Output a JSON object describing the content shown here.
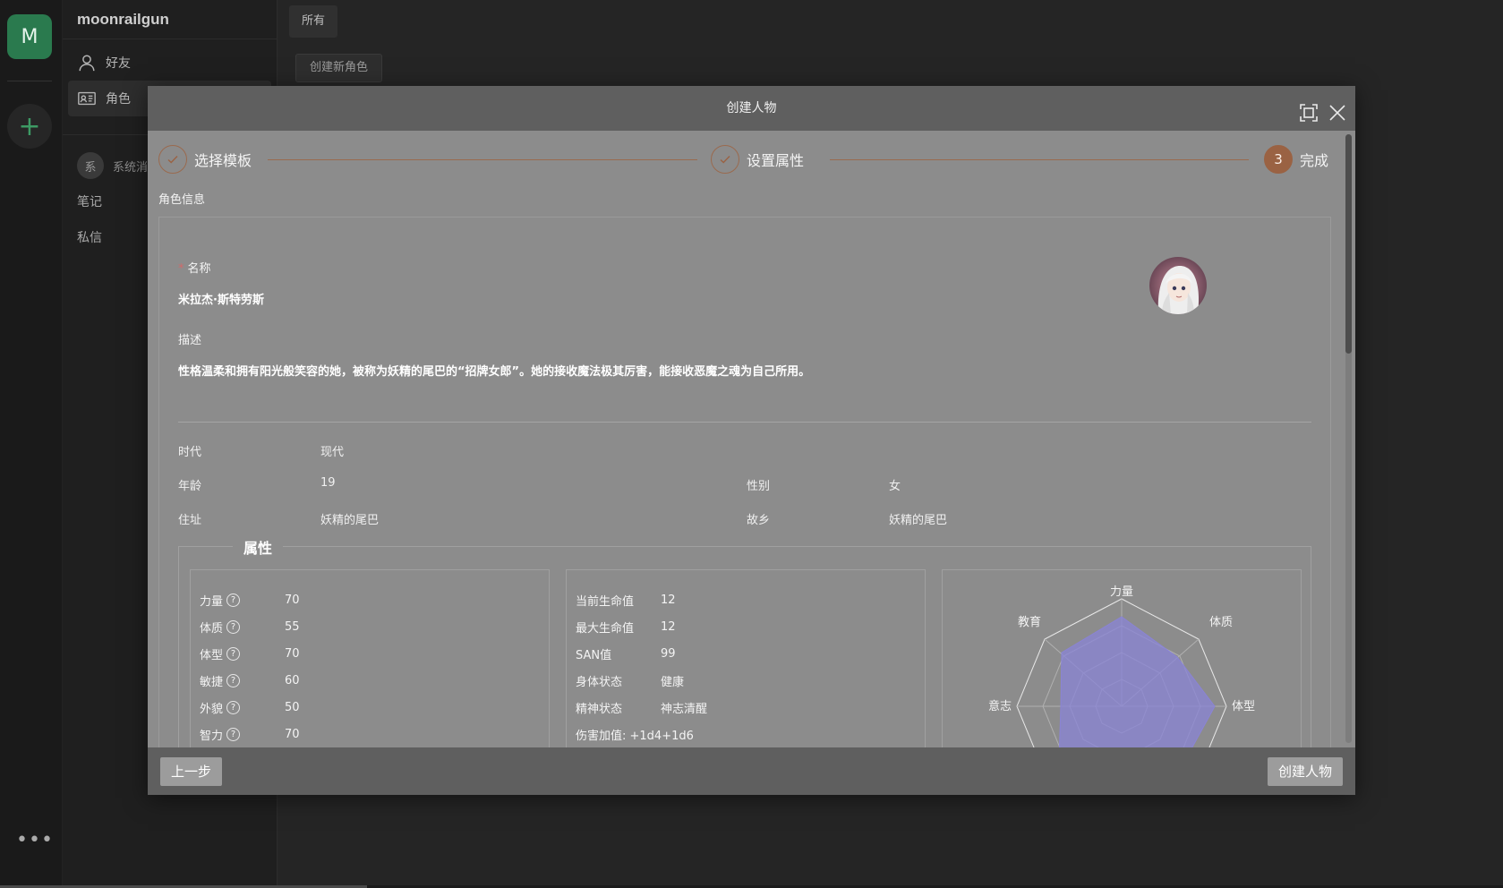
{
  "rail": {
    "avatar_letter": "M",
    "add_symbol": "+",
    "more_symbol": "•••"
  },
  "panel": {
    "username": "moonrailgun",
    "nav": [
      {
        "label": "好友",
        "icon": "user-icon"
      },
      {
        "label": "角色",
        "icon": "id-card-icon"
      }
    ],
    "system": {
      "badge": "系",
      "label": "系统消息"
    },
    "notes": "笔记",
    "dm": "私信"
  },
  "main": {
    "tab": "所有",
    "create_button": "创建新角色"
  },
  "modal": {
    "title": "创建人物",
    "steps": [
      {
        "label": "选择模板",
        "state": "done"
      },
      {
        "label": "设置属性",
        "state": "done"
      },
      {
        "label": "完成",
        "number": "3",
        "state": "active"
      }
    ],
    "section": "角色信息",
    "name_label": "名称",
    "name_value": "米拉杰·斯特劳斯",
    "desc_label": "描述",
    "desc_value": "性格温柔和拥有阳光般笑容的她，被称为妖精的尾巴的“招牌女郎”。她的接收魔法极其厉害，能接收恶魔之魂为自己所用。",
    "info": {
      "era_label": "时代",
      "era_value": "现代",
      "age_label": "年龄",
      "age_value": "19",
      "gender_label": "性别",
      "gender_value": "女",
      "address_label": "住址",
      "address_value": "妖精的尾巴",
      "hometown_label": "故乡",
      "hometown_value": "妖精的尾巴"
    },
    "attributes_title": "属性",
    "attributes": [
      {
        "label": "力量",
        "value": "70"
      },
      {
        "label": "体质",
        "value": "55"
      },
      {
        "label": "体型",
        "value": "70"
      },
      {
        "label": "敏捷",
        "value": "60"
      },
      {
        "label": "外貌",
        "value": "50"
      },
      {
        "label": "智力",
        "value": "70"
      }
    ],
    "status": [
      {
        "label": "当前生命值",
        "value": "12"
      },
      {
        "label": "最大生命值",
        "value": "12"
      },
      {
        "label": "SAN值",
        "value": "99"
      },
      {
        "label": "身体状态",
        "value": "健康"
      },
      {
        "label": "精神状态",
        "value": "神志清醒"
      }
    ],
    "damage_bonus": "伤害加值: +1d4+1d6",
    "radar": {
      "labels": [
        "力量",
        "体质",
        "体型",
        "意志",
        "教育"
      ],
      "fill_color": "#8a84d6"
    },
    "prev_button": "上一步",
    "create_button": "创建人物"
  },
  "colors": {
    "accent": "#9a6243",
    "brand": "#2a7a4e",
    "overlay": "#8c8c8c"
  }
}
